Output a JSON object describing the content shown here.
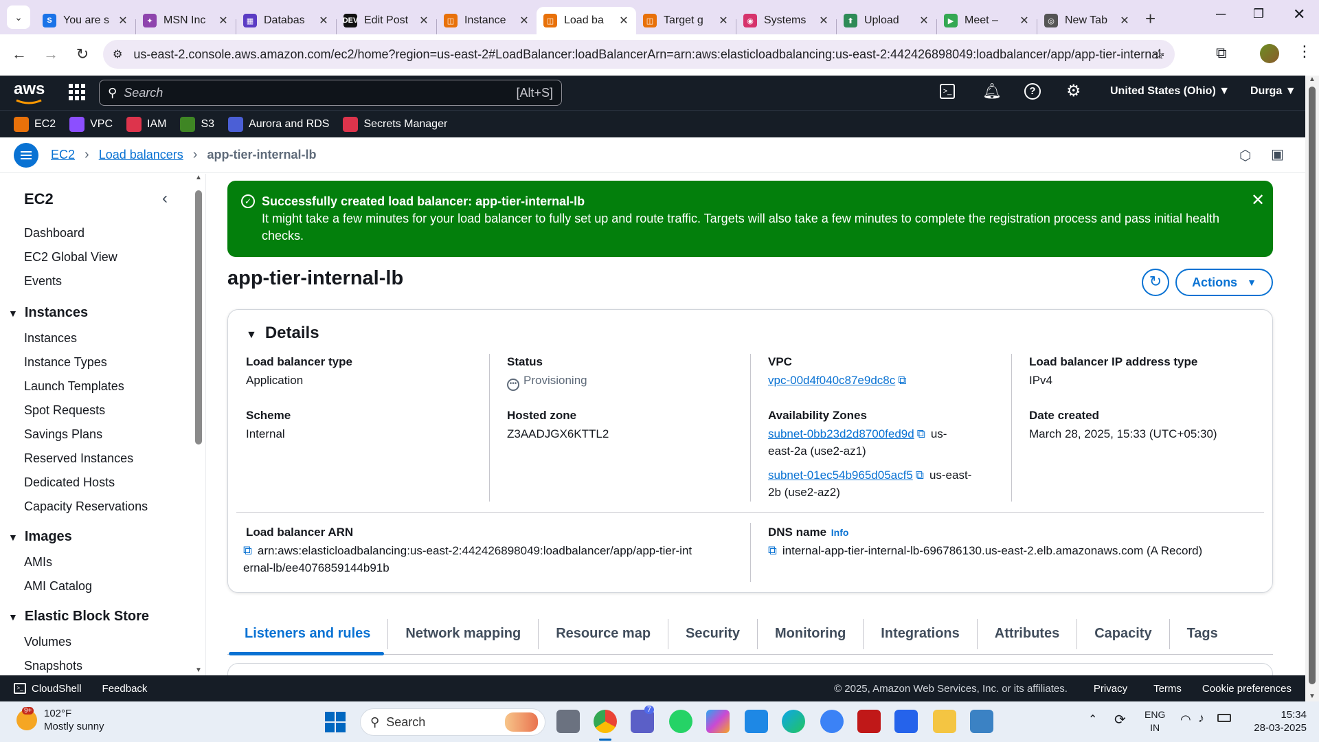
{
  "browser": {
    "tabs": [
      {
        "title": "You are s",
        "color": "#1a73e8",
        "glyph": "S"
      },
      {
        "title": "MSN Inc",
        "color": "#8e44ad",
        "glyph": "✦"
      },
      {
        "title": "Databas",
        "color": "#5b3cc4",
        "glyph": "▦"
      },
      {
        "title": "Edit Post",
        "color": "#111111",
        "glyph": "DEV"
      },
      {
        "title": "Instance",
        "color": "#e8710a",
        "glyph": "◫"
      },
      {
        "title": "Load ba",
        "color": "#e8710a",
        "glyph": "◫"
      },
      {
        "title": "Target g",
        "color": "#e8710a",
        "glyph": "◫"
      },
      {
        "title": "Systems",
        "color": "#d6336c",
        "glyph": "◉"
      },
      {
        "title": "Upload",
        "color": "#2e8b57",
        "glyph": "⬆"
      },
      {
        "title": "Meet –",
        "color": "#34a853",
        "glyph": "▶"
      },
      {
        "title": "New Tab",
        "color": "#555555",
        "glyph": "◎"
      }
    ],
    "active_tab_index": 5,
    "url": "us-east-2.console.aws.amazon.com/ec2/home?region=us-east-2#LoadBalancer:loadBalancerArn=arn:aws:elasticloadbalancing:us-east-2:442426898049:loadbalancer/app/app-tier-internal-lb/e..."
  },
  "aws_header": {
    "logo": "aws",
    "search_placeholder": "Search",
    "search_hint": "[Alt+S]",
    "region": "United States (Ohio)",
    "user": "Durga",
    "favorites": [
      {
        "label": "EC2",
        "color": "#e8710a"
      },
      {
        "label": "VPC",
        "color": "#8c4fff"
      },
      {
        "label": "IAM",
        "color": "#dd344c"
      },
      {
        "label": "S3",
        "color": "#3f8624"
      },
      {
        "label": "Aurora and RDS",
        "color": "#4b5fd6"
      },
      {
        "label": "Secrets Manager",
        "color": "#dd344c"
      }
    ]
  },
  "breadcrumb": {
    "items": [
      "EC2",
      "Load balancers"
    ],
    "current": "app-tier-internal-lb"
  },
  "sidebar": {
    "title": "EC2",
    "top_items": [
      "Dashboard",
      "EC2 Global View",
      "Events"
    ],
    "sections": [
      {
        "title": "Instances",
        "items": [
          "Instances",
          "Instance Types",
          "Launch Templates",
          "Spot Requests",
          "Savings Plans",
          "Reserved Instances",
          "Dedicated Hosts",
          "Capacity Reservations"
        ]
      },
      {
        "title": "Images",
        "items": [
          "AMIs",
          "AMI Catalog"
        ]
      },
      {
        "title": "Elastic Block Store",
        "items": [
          "Volumes",
          "Snapshots"
        ]
      }
    ]
  },
  "flash": {
    "title_prefix": "Successfully created load balancer: ",
    "title_name": "app-tier-internal-lb",
    "message": "It might take a few minutes for your load balancer to fully set up and route traffic. Targets will also take a few minutes to complete the registration process and pass initial health checks."
  },
  "page": {
    "title": "app-tier-internal-lb",
    "actions_label": "Actions"
  },
  "details": {
    "heading": "Details",
    "lb_type_label": "Load balancer type",
    "lb_type": "Application",
    "scheme_label": "Scheme",
    "scheme": "Internal",
    "status_label": "Status",
    "status": "Provisioning",
    "hosted_zone_label": "Hosted zone",
    "hosted_zone": "Z3AADJGX6KTTL2",
    "vpc_label": "VPC",
    "vpc": "vpc-00d4f040c87e9dc8c",
    "az_label": "Availability Zones",
    "az1_subnet": "subnet-0bb23d2d8700fed9d",
    "az1_zone_a": "us-",
    "az1_zone_b": "east-2a (use2-az1)",
    "az2_subnet": "subnet-01ec54b965d05acf5",
    "az2_zone_a": "us-east-",
    "az2_zone_b": "2b (use2-az2)",
    "ip_type_label": "Load balancer IP address type",
    "ip_type": "IPv4",
    "date_label": "Date created",
    "date": "March 28, 2025, 15:33 (UTC+05:30)",
    "arn_label": "Load balancer ARN",
    "arn_line1": "arn:aws:elasticloadbalancing:us-east-2:442426898049:loadbalancer/app/app-tier-int",
    "arn_line2": "ernal-lb/ee4076859144b91b",
    "dns_label": "DNS name",
    "dns_info": "Info",
    "dns": "internal-app-tier-internal-lb-696786130.us-east-2.elb.amazonaws.com (A Record)"
  },
  "tabs": [
    "Listeners and rules",
    "Network mapping",
    "Resource map",
    "Security",
    "Monitoring",
    "Integrations",
    "Attributes",
    "Capacity",
    "Tags"
  ],
  "footer": {
    "cloudshell": "CloudShell",
    "feedback": "Feedback",
    "copyright": "© 2025, Amazon Web Services, Inc. or its affiliates.",
    "privacy": "Privacy",
    "terms": "Terms",
    "cookie": "Cookie preferences"
  },
  "taskbar": {
    "weather_temp": "102°F",
    "weather_desc": "Mostly sunny",
    "weather_badge": "9+",
    "search_label": "Search",
    "teams_badge": "7",
    "lang1": "ENG",
    "lang2": "IN",
    "time": "15:34",
    "date": "28-03-2025"
  }
}
